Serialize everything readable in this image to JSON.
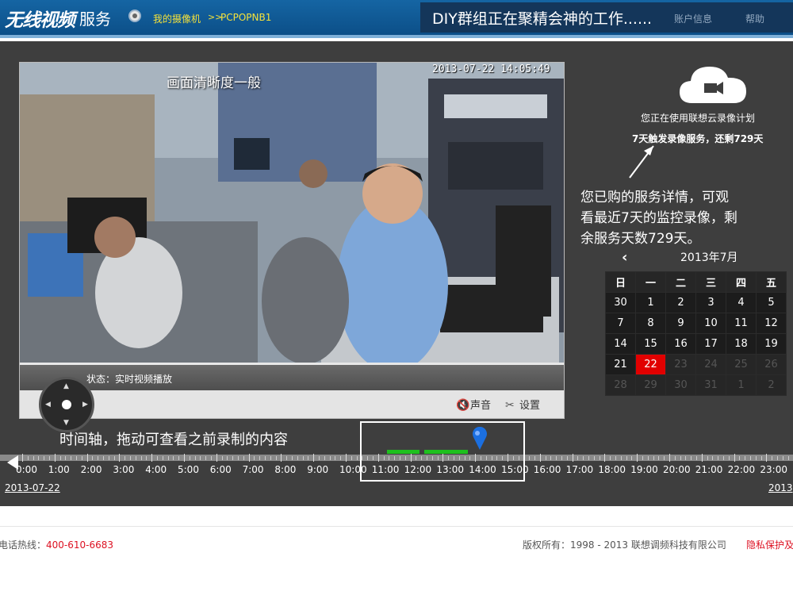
{
  "header": {
    "logo": "无线视频",
    "logo_sub": "服务",
    "breadcrumb_cameras": "我的摄像机",
    "breadcrumb_sep": ">>",
    "breadcrumb_device": "PCPOPNB1",
    "banner_message": "DIY群组正在聚精会神的工作......",
    "account_link": "账户信息",
    "help_link": "帮助"
  },
  "video": {
    "timestamp": "2013-07-22 14:05:49",
    "quality_note": "画面清晰度一般",
    "status": "状态：实时视频播放",
    "sound_label": "声音",
    "settings_label": "设置"
  },
  "annotations": {
    "timeline_note": "时间轴，拖动可查看之前录制的内容",
    "service_note_lines": [
      "您已购的服务详情，可观",
      "看最近7天的监控录像，剩",
      "余服务天数729天。"
    ]
  },
  "cloud_plan": {
    "line1": "您正在使用联想云录像计划",
    "line2": "7天触发录像服务，还剩729天"
  },
  "calendar": {
    "prev": "‹",
    "title": "2013年7月",
    "weekdays": [
      "日",
      "一",
      "二",
      "三",
      "四",
      "五"
    ],
    "rows": [
      [
        "30",
        "1",
        "2",
        "3",
        "4",
        "5"
      ],
      [
        "7",
        "8",
        "9",
        "10",
        "11",
        "12"
      ],
      [
        "14",
        "15",
        "16",
        "17",
        "18",
        "19"
      ],
      [
        "21",
        "22",
        "23",
        "24",
        "25",
        "26"
      ],
      [
        "28",
        "29",
        "30",
        "31",
        "1",
        "2"
      ]
    ],
    "selected_day": "22"
  },
  "timeline": {
    "hours": [
      "0:00",
      "1:00",
      "2:00",
      "3:00",
      "4:00",
      "5:00",
      "6:00",
      "7:00",
      "8:00",
      "9:00",
      "10:00",
      "11:00",
      "12:00",
      "13:00",
      "14:00",
      "15:00",
      "16:00",
      "17:00",
      "18:00",
      "19:00",
      "20:00",
      "21:00",
      "22:00",
      "23:00"
    ],
    "date_left": "2013-07-22",
    "date_right": "2013"
  },
  "footer": {
    "hotline_label": "电话热线：",
    "hotline_number": "400-610-6683",
    "copyright": "版权所有：1998 - 2013 联想调频科技有限公司",
    "privacy": "隐私保护及"
  },
  "colors": {
    "header_blue": "#1565a3",
    "main_bg": "#3e3e3e",
    "record_green": "#1ec01e",
    "selected_red": "#e10000",
    "link_yellow": "#f5e23a"
  }
}
